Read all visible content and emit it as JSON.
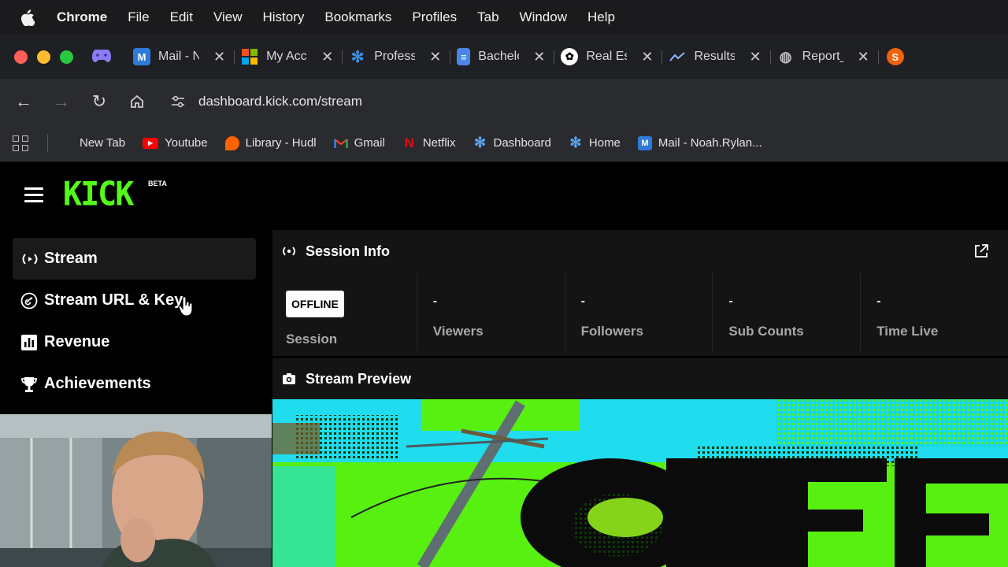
{
  "menubar": {
    "app": "Chrome",
    "items": [
      "File",
      "Edit",
      "View",
      "History",
      "Bookmarks",
      "Profiles",
      "Tab",
      "Window",
      "Help"
    ]
  },
  "tabs": [
    {
      "title": "Mail - N",
      "icon": "outlook-icon",
      "color": "#2f7ad8"
    },
    {
      "title": "My Acc",
      "icon": "microsoft-icon",
      "color": "#f25022"
    },
    {
      "title": "Profess",
      "icon": "gear-icon",
      "color": "#3b8de0"
    },
    {
      "title": "Bachelo",
      "icon": "docs-icon",
      "color": "#4a86e8"
    },
    {
      "title": "Real Es",
      "icon": "openai-icon",
      "color": "#ffffff"
    },
    {
      "title": "Results",
      "icon": "chart-icon",
      "color": "#34a0ff"
    },
    {
      "title": "Report_",
      "icon": "globe-icon",
      "color": "#bbbbbb"
    }
  ],
  "address": {
    "url": "dashboard.kick.com/stream"
  },
  "bookmarks": [
    {
      "label": "New Tab",
      "icon": "blank-icon",
      "color": "#2a2b2f"
    },
    {
      "label": "Youtube",
      "icon": "youtube-icon",
      "color": "#ff0000"
    },
    {
      "label": "Library - Hudl",
      "icon": "hudl-icon",
      "color": "#ff6300"
    },
    {
      "label": "Gmail",
      "icon": "gmail-icon",
      "color": "#ea4335"
    },
    {
      "label": "Netflix",
      "icon": "netflix-icon",
      "color": "#e50914"
    },
    {
      "label": "Dashboard",
      "icon": "gear-icon",
      "color": "#3b8de0"
    },
    {
      "label": "Home",
      "icon": "gear-icon",
      "color": "#3b8de0"
    },
    {
      "label": "Mail - Noah.Rylan...",
      "icon": "outlook-icon",
      "color": "#2f7ad8"
    }
  ],
  "kick": {
    "logo": "KICK",
    "beta": "BETA",
    "accent": "#53fc18",
    "sidebar": [
      {
        "label": "Stream",
        "icon": "broadcast-icon"
      },
      {
        "label": "Stream URL & Key",
        "icon": "link-icon"
      },
      {
        "label": "Revenue",
        "icon": "bar-chart-icon"
      },
      {
        "label": "Achievements",
        "icon": "trophy-icon"
      }
    ],
    "session": {
      "title": "Session Info",
      "status": "OFFLINE",
      "session_label": "Session",
      "stats": [
        {
          "value": "-",
          "label": "Viewers"
        },
        {
          "value": "-",
          "label": "Followers"
        },
        {
          "value": "-",
          "label": "Sub Counts"
        },
        {
          "value": "-",
          "label": "Time Live"
        }
      ]
    },
    "preview": {
      "title": "Stream Preview"
    }
  }
}
